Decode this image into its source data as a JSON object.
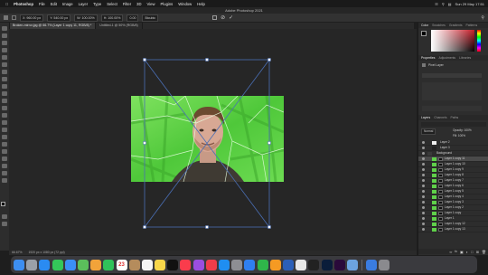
{
  "menubar": {
    "app": "Photoshop",
    "items": [
      "File",
      "Edit",
      "Image",
      "Layer",
      "Type",
      "Select",
      "Filter",
      "3D",
      "View",
      "Plugins",
      "Window",
      "Help"
    ],
    "clock": "Sun 29 May 17:51"
  },
  "window": {
    "title": "Adobe Photoshop 2021"
  },
  "options": {
    "fields": [
      "X: 960.00 px",
      "Y: 540.00 px",
      "W: 100.00%",
      "H: 100.00%",
      "0.00"
    ],
    "interp": "Bicubic"
  },
  "doc_tabs": [
    {
      "label": "Broken-mirror.jpg @ 66.7% (Layer 1 copy 11, RGB/8) *",
      "active": true
    },
    {
      "label": "Untitled-1 @ 50% (RGB/8)",
      "active": false
    }
  ],
  "status": {
    "zoom": "66.67%",
    "info": "1920 px x 1080 px (72 ppi)"
  },
  "panels": {
    "top_tabs": [
      "Color",
      "Swatches",
      "Gradients",
      "Patterns"
    ],
    "properties_tabs": [
      "Properties",
      "Adjustments",
      "Libraries"
    ],
    "properties_label": "Pixel Layer",
    "layers_tabs": [
      "Layers",
      "Channels",
      "Paths"
    ],
    "blend_mode": "Normal",
    "opacity": "Opacity: 100%",
    "fill": "Fill: 100%",
    "layers": [
      "Layer 2",
      "Layer 3",
      "Background",
      "Layer 1 copy 11",
      "Layer 1 copy 10",
      "Layer 1 copy 9",
      "Layer 1 copy 8",
      "Layer 1 copy 7",
      "Layer 1 copy 6",
      "Layer 1 copy 5",
      "Layer 1 copy 4",
      "Layer 1 copy 3",
      "Layer 1 copy 2",
      "Layer 1 copy",
      "Layer 1",
      "Layer 1 copy 12",
      "Layer 1 copy 13"
    ]
  },
  "colors": {
    "accent": "#2d6cdf",
    "green_screen": "#5fd04a"
  },
  "dock": {
    "calendar_day": "23",
    "apps": [
      "finder",
      "launchpad",
      "safari",
      "messages",
      "mail",
      "maps",
      "photos",
      "facetime",
      "calendar",
      "contacts",
      "reminders",
      "notes",
      "tv",
      "music",
      "podcasts",
      "news",
      "appstore",
      "settings",
      "keynote",
      "numbers",
      "pages",
      "word",
      "chrome",
      "terminal",
      "photoshop",
      "premiere",
      "preview",
      "downloads",
      "trash"
    ]
  }
}
